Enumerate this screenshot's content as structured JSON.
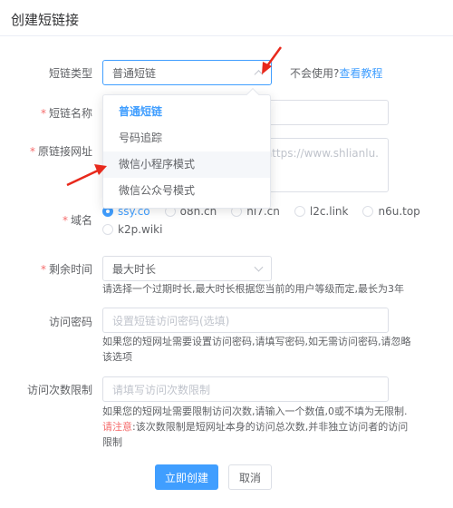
{
  "dialog": {
    "title": "创建短链接"
  },
  "form": {
    "type": {
      "label": "短链类型",
      "value": "普通短链"
    },
    "help": {
      "text": "不会使用?",
      "link": "查看教程"
    },
    "name": {
      "required": "*",
      "label": "短链名称"
    },
    "url": {
      "required": "*",
      "label": "原链接网址",
      "placeholder_tail": "址：https://www.shlianlu."
    },
    "domain": {
      "required": "*",
      "label": "域名",
      "options": [
        "ssy.co",
        "o8n.cn",
        "hi7.cn",
        "l2c.link",
        "n6u.top",
        "k2p.wiki"
      ],
      "selected": 0
    },
    "expiry": {
      "required": "*",
      "label": "剩余时间",
      "value": "最大时长",
      "hint": "请选择一个过期时长,最大时长根据您当前的用户等级而定,最长为3年"
    },
    "password": {
      "label": "访问密码",
      "placeholder": "设置短链访问密码(选填)",
      "hint_line1": "如果您的短网址需要设置访问密码,请填写密码,如无需访问密码,请忽略",
      "hint_line2": "该选项"
    },
    "limit": {
      "label": "访问次数限制",
      "placeholder": "请填写访问次数限制",
      "hint_line1": "如果您的短网址需要限制访问次数,请输入一个数值,0或不填为无限制.",
      "warn": "请注意",
      "hint_line2": ":该次数限制是短网址本身的访问总次数,并非独立访问者的访问",
      "hint_line3": "限制"
    }
  },
  "dropdown": {
    "items": [
      "普通短链",
      "号码追踪",
      "微信小程序模式",
      "微信公众号模式"
    ],
    "selected": 0,
    "hovered": 2
  },
  "buttons": {
    "submit": "立即创建",
    "cancel": "取消"
  },
  "colors": {
    "primary": "#409eff",
    "danger": "#f56c6c",
    "annotation": "#e8291c"
  }
}
